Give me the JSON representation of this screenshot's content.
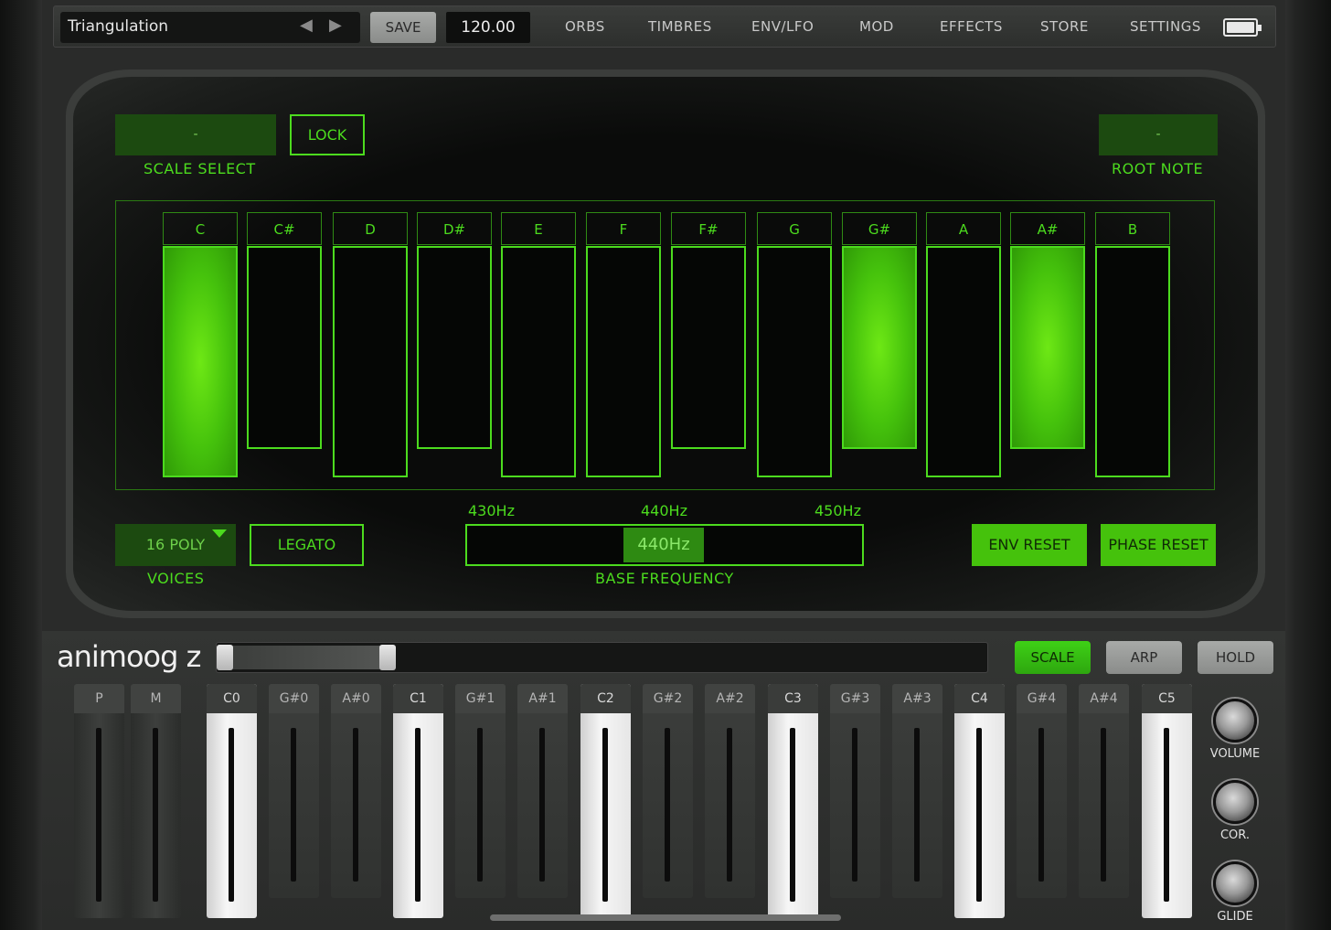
{
  "header": {
    "preset_name": "Triangulation",
    "save_label": "SAVE",
    "tempo": "120.00",
    "nav": [
      "ORBS",
      "TIMBRES",
      "ENV/LFO",
      "MOD",
      "EFFECTS",
      "STORE",
      "SETTINGS"
    ]
  },
  "scale_screen": {
    "scale_value": "-",
    "scale_label": "SCALE SELECT",
    "lock_label": "LOCK",
    "root_value": "-",
    "root_label": "ROOT NOTE",
    "notes": [
      {
        "name": "C",
        "active": true
      },
      {
        "name": "C#",
        "active": false
      },
      {
        "name": "D",
        "active": false
      },
      {
        "name": "D#",
        "active": false
      },
      {
        "name": "E",
        "active": false
      },
      {
        "name": "F",
        "active": false
      },
      {
        "name": "F#",
        "active": false
      },
      {
        "name": "G",
        "active": false
      },
      {
        "name": "G#",
        "active": true
      },
      {
        "name": "A",
        "active": false
      },
      {
        "name": "A#",
        "active": true
      },
      {
        "name": "B",
        "active": false
      }
    ],
    "voices_value": "16 POLY",
    "voices_label": "VOICES",
    "legato_label": "LEGATO",
    "freq_ticks": [
      "430Hz",
      "440Hz",
      "450Hz"
    ],
    "freq_value": "440Hz",
    "freq_label": "BASE FREQUENCY",
    "env_reset_label": "ENV RESET",
    "phase_reset_label": "PHASE RESET"
  },
  "keyboard": {
    "logo": "animoog z",
    "modes": [
      {
        "label": "SCALE",
        "active": true
      },
      {
        "label": "ARP",
        "active": false
      },
      {
        "label": "HOLD",
        "active": false
      }
    ],
    "keys": [
      {
        "label": "P",
        "kind": "pm"
      },
      {
        "label": "M",
        "kind": "pm"
      },
      {
        "label": "C0",
        "kind": "white"
      },
      {
        "label": "G#0",
        "kind": "dark"
      },
      {
        "label": "A#0",
        "kind": "dark"
      },
      {
        "label": "C1",
        "kind": "white"
      },
      {
        "label": "G#1",
        "kind": "dark"
      },
      {
        "label": "A#1",
        "kind": "dark"
      },
      {
        "label": "C2",
        "kind": "white"
      },
      {
        "label": "G#2",
        "kind": "dark"
      },
      {
        "label": "A#2",
        "kind": "dark"
      },
      {
        "label": "C3",
        "kind": "white"
      },
      {
        "label": "G#3",
        "kind": "dark"
      },
      {
        "label": "A#3",
        "kind": "dark"
      },
      {
        "label": "C4",
        "kind": "white"
      },
      {
        "label": "G#4",
        "kind": "dark"
      },
      {
        "label": "A#4",
        "kind": "dark"
      },
      {
        "label": "C5",
        "kind": "white"
      }
    ],
    "knobs": [
      "VOLUME",
      "COR.",
      "GLIDE"
    ]
  }
}
